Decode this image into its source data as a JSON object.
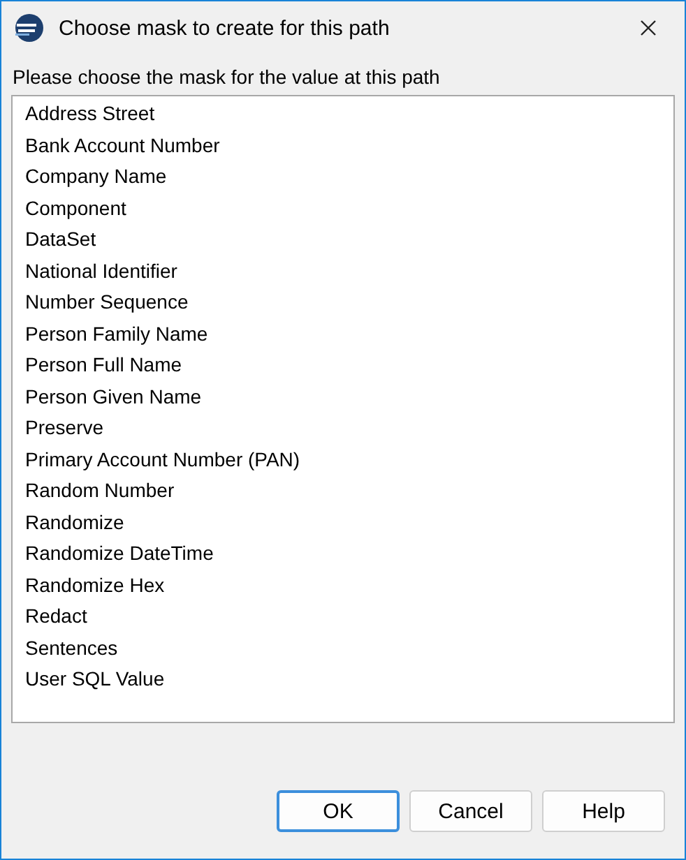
{
  "window": {
    "title": "Choose mask to create for this path"
  },
  "prompt": "Please choose the mask for the value at this path",
  "masks": [
    {
      "label": "Address Street",
      "selected": false
    },
    {
      "label": "Bank Account Number",
      "selected": false
    },
    {
      "label": "Company Name",
      "selected": false
    },
    {
      "label": "Component",
      "selected": false
    },
    {
      "label": "DataSet",
      "selected": false
    },
    {
      "label": "National Identifier",
      "selected": false
    },
    {
      "label": "Number Sequence",
      "selected": false
    },
    {
      "label": "Person Family Name",
      "selected": false
    },
    {
      "label": "Person Full Name",
      "selected": false
    },
    {
      "label": "Person Given Name",
      "selected": false
    },
    {
      "label": "Preserve",
      "selected": false
    },
    {
      "label": "Primary Account Number (PAN)",
      "selected": false
    },
    {
      "label": "Random Number",
      "selected": false
    },
    {
      "label": "Randomize",
      "selected": false
    },
    {
      "label": "Randomize DateTime",
      "selected": false
    },
    {
      "label": "Randomize Hex",
      "selected": false
    },
    {
      "label": "Redact",
      "selected": false
    },
    {
      "label": "Sentences",
      "selected": false
    },
    {
      "label": "User SQL Value",
      "selected": false
    }
  ],
  "buttons": [
    {
      "label": "OK",
      "default": true
    },
    {
      "label": "Cancel",
      "default": false
    },
    {
      "label": "Help",
      "default": false
    }
  ]
}
